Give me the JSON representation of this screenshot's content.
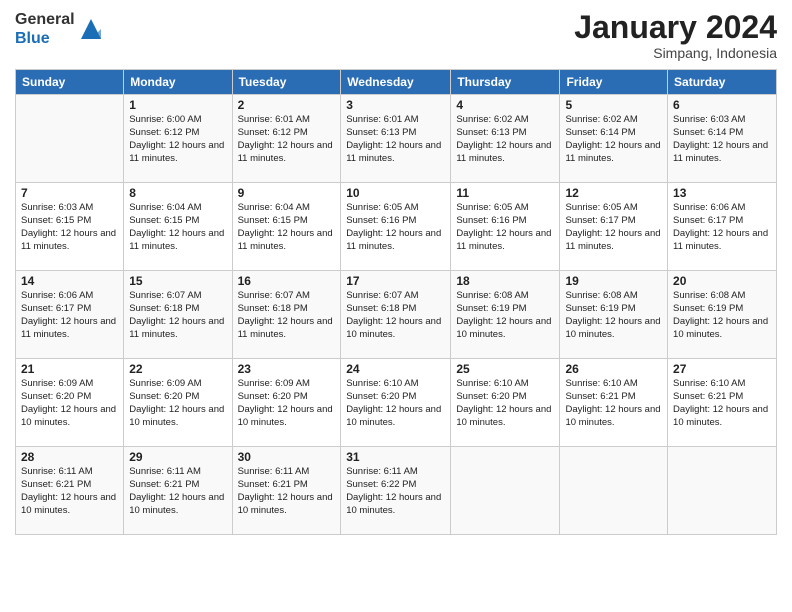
{
  "header": {
    "logo_line1": "General",
    "logo_line2": "Blue",
    "month_title": "January 2024",
    "location": "Simpang, Indonesia"
  },
  "weekdays": [
    "Sunday",
    "Monday",
    "Tuesday",
    "Wednesday",
    "Thursday",
    "Friday",
    "Saturday"
  ],
  "weeks": [
    [
      {
        "day": "",
        "sunrise": "",
        "sunset": "",
        "daylight": ""
      },
      {
        "day": "1",
        "sunrise": "Sunrise: 6:00 AM",
        "sunset": "Sunset: 6:12 PM",
        "daylight": "Daylight: 12 hours and 11 minutes."
      },
      {
        "day": "2",
        "sunrise": "Sunrise: 6:01 AM",
        "sunset": "Sunset: 6:12 PM",
        "daylight": "Daylight: 12 hours and 11 minutes."
      },
      {
        "day": "3",
        "sunrise": "Sunrise: 6:01 AM",
        "sunset": "Sunset: 6:13 PM",
        "daylight": "Daylight: 12 hours and 11 minutes."
      },
      {
        "day": "4",
        "sunrise": "Sunrise: 6:02 AM",
        "sunset": "Sunset: 6:13 PM",
        "daylight": "Daylight: 12 hours and 11 minutes."
      },
      {
        "day": "5",
        "sunrise": "Sunrise: 6:02 AM",
        "sunset": "Sunset: 6:14 PM",
        "daylight": "Daylight: 12 hours and 11 minutes."
      },
      {
        "day": "6",
        "sunrise": "Sunrise: 6:03 AM",
        "sunset": "Sunset: 6:14 PM",
        "daylight": "Daylight: 12 hours and 11 minutes."
      }
    ],
    [
      {
        "day": "7",
        "sunrise": "Sunrise: 6:03 AM",
        "sunset": "Sunset: 6:15 PM",
        "daylight": "Daylight: 12 hours and 11 minutes."
      },
      {
        "day": "8",
        "sunrise": "Sunrise: 6:04 AM",
        "sunset": "Sunset: 6:15 PM",
        "daylight": "Daylight: 12 hours and 11 minutes."
      },
      {
        "day": "9",
        "sunrise": "Sunrise: 6:04 AM",
        "sunset": "Sunset: 6:15 PM",
        "daylight": "Daylight: 12 hours and 11 minutes."
      },
      {
        "day": "10",
        "sunrise": "Sunrise: 6:05 AM",
        "sunset": "Sunset: 6:16 PM",
        "daylight": "Daylight: 12 hours and 11 minutes."
      },
      {
        "day": "11",
        "sunrise": "Sunrise: 6:05 AM",
        "sunset": "Sunset: 6:16 PM",
        "daylight": "Daylight: 12 hours and 11 minutes."
      },
      {
        "day": "12",
        "sunrise": "Sunrise: 6:05 AM",
        "sunset": "Sunset: 6:17 PM",
        "daylight": "Daylight: 12 hours and 11 minutes."
      },
      {
        "day": "13",
        "sunrise": "Sunrise: 6:06 AM",
        "sunset": "Sunset: 6:17 PM",
        "daylight": "Daylight: 12 hours and 11 minutes."
      }
    ],
    [
      {
        "day": "14",
        "sunrise": "Sunrise: 6:06 AM",
        "sunset": "Sunset: 6:17 PM",
        "daylight": "Daylight: 12 hours and 11 minutes."
      },
      {
        "day": "15",
        "sunrise": "Sunrise: 6:07 AM",
        "sunset": "Sunset: 6:18 PM",
        "daylight": "Daylight: 12 hours and 11 minutes."
      },
      {
        "day": "16",
        "sunrise": "Sunrise: 6:07 AM",
        "sunset": "Sunset: 6:18 PM",
        "daylight": "Daylight: 12 hours and 11 minutes."
      },
      {
        "day": "17",
        "sunrise": "Sunrise: 6:07 AM",
        "sunset": "Sunset: 6:18 PM",
        "daylight": "Daylight: 12 hours and 10 minutes."
      },
      {
        "day": "18",
        "sunrise": "Sunrise: 6:08 AM",
        "sunset": "Sunset: 6:19 PM",
        "daylight": "Daylight: 12 hours and 10 minutes."
      },
      {
        "day": "19",
        "sunrise": "Sunrise: 6:08 AM",
        "sunset": "Sunset: 6:19 PM",
        "daylight": "Daylight: 12 hours and 10 minutes."
      },
      {
        "day": "20",
        "sunrise": "Sunrise: 6:08 AM",
        "sunset": "Sunset: 6:19 PM",
        "daylight": "Daylight: 12 hours and 10 minutes."
      }
    ],
    [
      {
        "day": "21",
        "sunrise": "Sunrise: 6:09 AM",
        "sunset": "Sunset: 6:20 PM",
        "daylight": "Daylight: 12 hours and 10 minutes."
      },
      {
        "day": "22",
        "sunrise": "Sunrise: 6:09 AM",
        "sunset": "Sunset: 6:20 PM",
        "daylight": "Daylight: 12 hours and 10 minutes."
      },
      {
        "day": "23",
        "sunrise": "Sunrise: 6:09 AM",
        "sunset": "Sunset: 6:20 PM",
        "daylight": "Daylight: 12 hours and 10 minutes."
      },
      {
        "day": "24",
        "sunrise": "Sunrise: 6:10 AM",
        "sunset": "Sunset: 6:20 PM",
        "daylight": "Daylight: 12 hours and 10 minutes."
      },
      {
        "day": "25",
        "sunrise": "Sunrise: 6:10 AM",
        "sunset": "Sunset: 6:20 PM",
        "daylight": "Daylight: 12 hours and 10 minutes."
      },
      {
        "day": "26",
        "sunrise": "Sunrise: 6:10 AM",
        "sunset": "Sunset: 6:21 PM",
        "daylight": "Daylight: 12 hours and 10 minutes."
      },
      {
        "day": "27",
        "sunrise": "Sunrise: 6:10 AM",
        "sunset": "Sunset: 6:21 PM",
        "daylight": "Daylight: 12 hours and 10 minutes."
      }
    ],
    [
      {
        "day": "28",
        "sunrise": "Sunrise: 6:11 AM",
        "sunset": "Sunset: 6:21 PM",
        "daylight": "Daylight: 12 hours and 10 minutes."
      },
      {
        "day": "29",
        "sunrise": "Sunrise: 6:11 AM",
        "sunset": "Sunset: 6:21 PM",
        "daylight": "Daylight: 12 hours and 10 minutes."
      },
      {
        "day": "30",
        "sunrise": "Sunrise: 6:11 AM",
        "sunset": "Sunset: 6:21 PM",
        "daylight": "Daylight: 12 hours and 10 minutes."
      },
      {
        "day": "31",
        "sunrise": "Sunrise: 6:11 AM",
        "sunset": "Sunset: 6:22 PM",
        "daylight": "Daylight: 12 hours and 10 minutes."
      },
      {
        "day": "",
        "sunrise": "",
        "sunset": "",
        "daylight": ""
      },
      {
        "day": "",
        "sunrise": "",
        "sunset": "",
        "daylight": ""
      },
      {
        "day": "",
        "sunrise": "",
        "sunset": "",
        "daylight": ""
      }
    ]
  ]
}
